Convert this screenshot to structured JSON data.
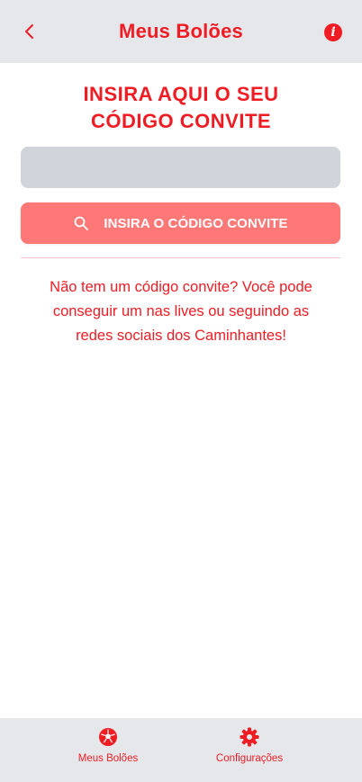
{
  "header": {
    "title": "Meus Bolões",
    "back_icon": "chevron-left-icon",
    "info_icon": "info-icon",
    "info_glyph": "i"
  },
  "main": {
    "title_line1": "INSIRA AQUI O SEU",
    "title_line2": "CÓDIGO CONVITE",
    "code_input": {
      "value": "",
      "placeholder": ""
    },
    "submit_button": {
      "label": "INSIRA O CÓDIGO CONVITE",
      "icon": "search-icon"
    },
    "help_line1": "Não tem um código convite? Você pode",
    "help_line2": "conseguir um nas lives ou seguindo as",
    "help_line3": "redes sociais dos Caminhantes!"
  },
  "bottom_nav": {
    "items": [
      {
        "label": "Meus Bolões",
        "icon": "soccer-ball-icon"
      },
      {
        "label": "Configurações",
        "icon": "gear-icon"
      }
    ]
  },
  "colors": {
    "accent": "#ef1c24",
    "button_bg": "#ff7878",
    "header_bg": "#e5e7eb",
    "input_bg": "#d1d5db"
  }
}
